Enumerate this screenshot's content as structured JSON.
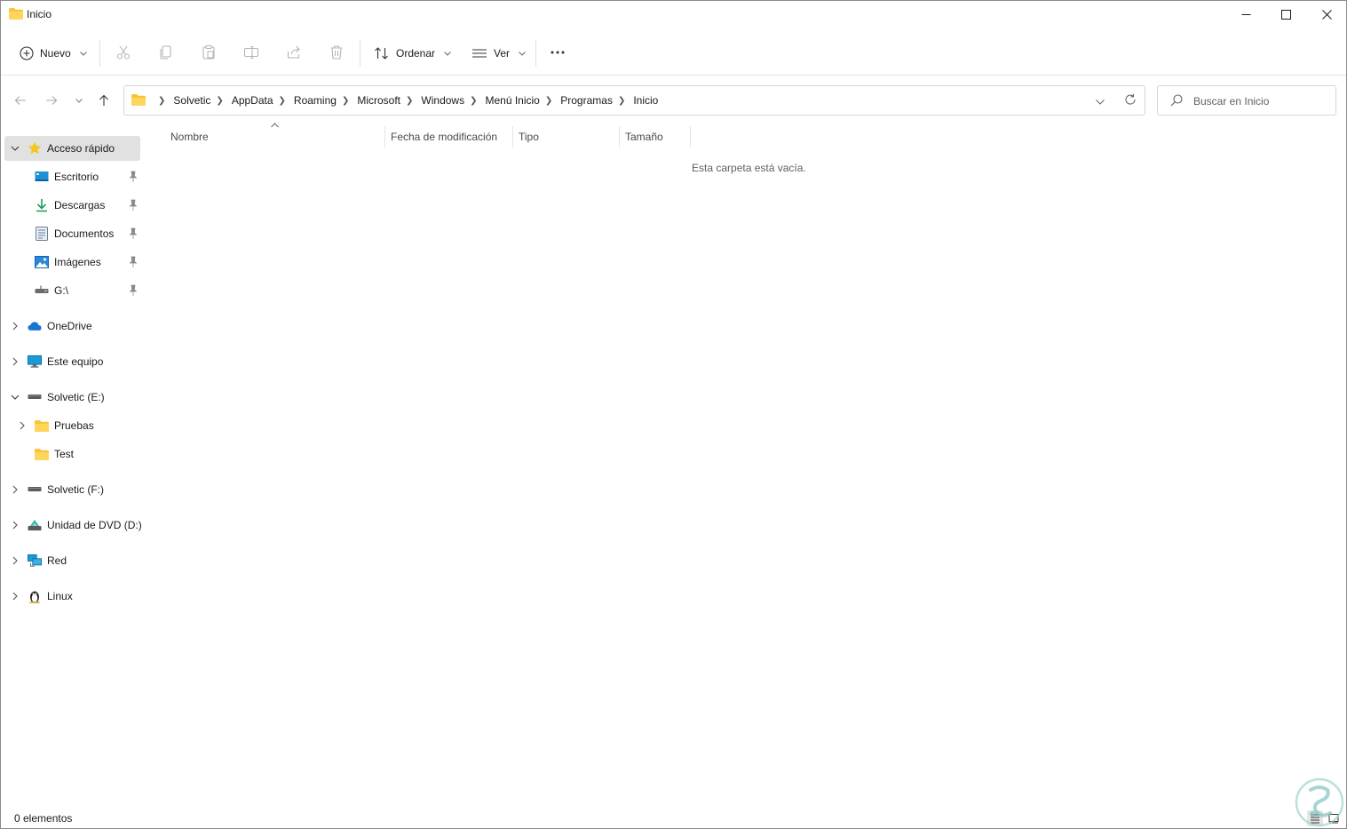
{
  "window": {
    "title": "Inicio",
    "controls": [
      "minimize",
      "maximize",
      "close"
    ]
  },
  "toolbar": {
    "new_label": "Nuevo",
    "sort_label": "Ordenar",
    "view_label": "Ver",
    "more_label": "···",
    "icons": [
      "cut-icon",
      "copy-icon",
      "paste-icon",
      "rename-icon",
      "share-icon",
      "delete-icon"
    ]
  },
  "address": {
    "breadcrumbs": [
      "Solvetic",
      "AppData",
      "Roaming",
      "Microsoft",
      "Windows",
      "Menú Inicio",
      "Programas",
      "Inicio"
    ]
  },
  "search": {
    "placeholder": "Buscar en Inicio"
  },
  "sidebar": {
    "quick_access": "Acceso rápido",
    "pinned": [
      "Escritorio",
      "Descargas",
      "Documentos",
      "Imágenes",
      "G:\\"
    ],
    "onedrive": "OneDrive",
    "this_pc": "Este equipo",
    "drive_e": "Solvetic (E:)",
    "drive_e_children": [
      "Pruebas",
      "Test"
    ],
    "drive_f": "Solvetic (F:)",
    "dvd": "Unidad de DVD (D:)",
    "network": "Red",
    "linux": "Linux"
  },
  "columns": [
    "Nombre",
    "Fecha de modificación",
    "Tipo",
    "Tamaño"
  ],
  "content": {
    "empty_message": "Esta carpeta está vacía."
  },
  "status": {
    "item_count": "0 elementos"
  },
  "colors": {
    "folder_yellow": "#f8c43a",
    "accent_blue": "#0078d4",
    "selection_gray": "#e1e1e1"
  }
}
